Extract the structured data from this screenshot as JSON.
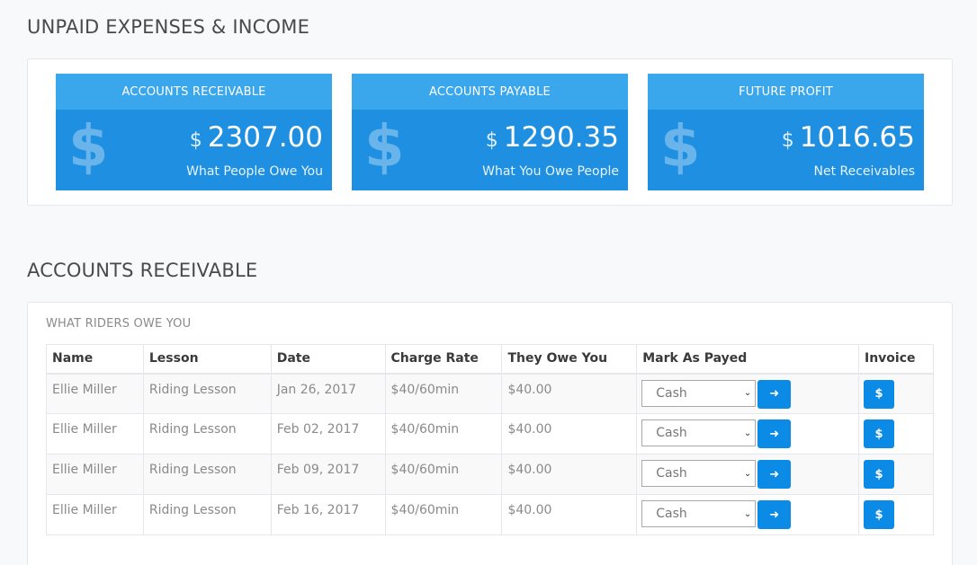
{
  "page": {
    "section1_title": "UNPAID EXPENSES & INCOME",
    "section2_title": "ACCOUNTS RECEIVABLE"
  },
  "cards": [
    {
      "title": "ACCOUNTS RECEIVABLE",
      "currency": "$",
      "amount": "2307.00",
      "subtitle": "What People Owe You",
      "icon": "dollar-icon"
    },
    {
      "title": "ACCOUNTS PAYABLE",
      "currency": "$",
      "amount": "1290.35",
      "subtitle": "What You Owe People",
      "icon": "dollar-icon"
    },
    {
      "title": "FUTURE PROFIT",
      "currency": "$",
      "amount": "1016.65",
      "subtitle": "Net Receivables",
      "icon": "dollar-icon"
    }
  ],
  "receivables": {
    "subtitle": "WHAT RIDERS OWE YOU",
    "columns": [
      "Name",
      "Lesson",
      "Date",
      "Charge Rate",
      "They Owe You",
      "Mark As Payed",
      "Invoice"
    ],
    "rows": [
      {
        "name": "Ellie Miller",
        "lesson": "Riding Lesson",
        "date": "Jan 26, 2017",
        "rate": "$40/60min",
        "owe": "$40.00",
        "method": "Cash"
      },
      {
        "name": "Ellie Miller",
        "lesson": "Riding Lesson",
        "date": "Feb 02, 2017",
        "rate": "$40/60min",
        "owe": "$40.00",
        "method": "Cash"
      },
      {
        "name": "Ellie Miller",
        "lesson": "Riding Lesson",
        "date": "Feb 09, 2017",
        "rate": "$40/60min",
        "owe": "$40.00",
        "method": "Cash"
      },
      {
        "name": "Ellie Miller",
        "lesson": "Riding Lesson",
        "date": "Feb 16, 2017",
        "rate": "$40/60min",
        "owe": "$40.00",
        "method": "Cash"
      }
    ],
    "submit_icon": "arrow-right-icon",
    "invoice_icon": "dollar-icon",
    "invoice_glyph": "$"
  },
  "colors": {
    "card_body": "#1e8fe1",
    "card_header": "#3aa6ec",
    "button": "#0b8ae6"
  }
}
